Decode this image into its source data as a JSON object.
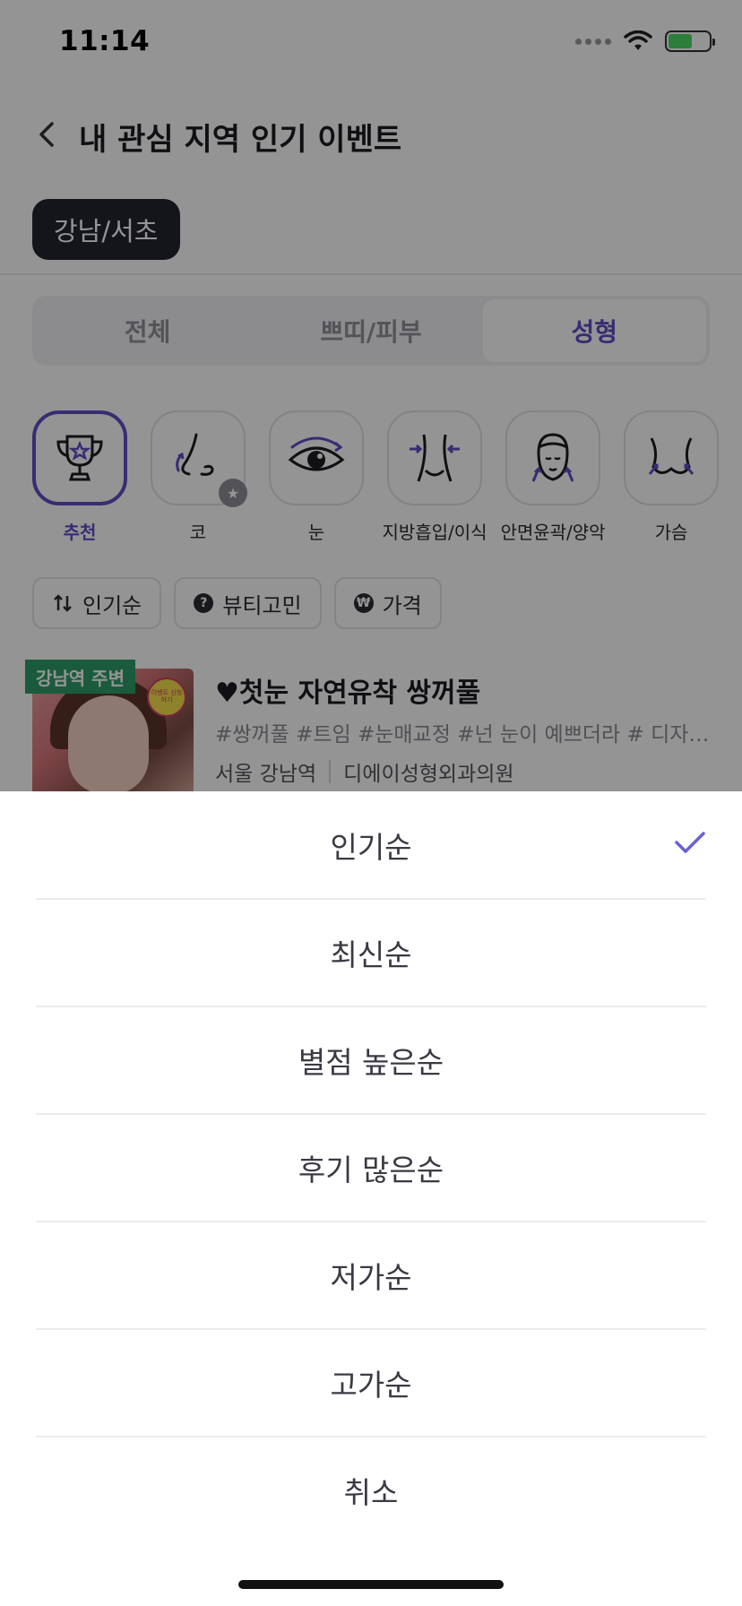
{
  "status_bar": {
    "time": "11:14",
    "battery_icon": "battery-charging-icon",
    "wifi_icon": "wifi-icon"
  },
  "header": {
    "title": "내 관심 지역 인기 이벤트",
    "back_icon": "chevron-left-icon"
  },
  "region_chip": "강남/서초",
  "segment": {
    "tabs": [
      "전체",
      "쁘띠/피부",
      "성형"
    ],
    "active_index": 2
  },
  "categories": [
    {
      "label": "추천",
      "icon": "trophy-icon",
      "active": true
    },
    {
      "label": "코",
      "icon": "nose-icon"
    },
    {
      "label": "눈",
      "icon": "eye-icon"
    },
    {
      "label": "지방흡입/이식",
      "icon": "waist-icon"
    },
    {
      "label": "안면윤곽/양악",
      "icon": "face-icon"
    },
    {
      "label": "가슴",
      "icon": "chest-icon"
    }
  ],
  "filters": [
    {
      "label": "인기순",
      "icon": "sort-icon"
    },
    {
      "label": "뷰티고민",
      "icon": "question-icon"
    },
    {
      "label": "가격",
      "icon": "won-icon"
    }
  ],
  "event": {
    "badge": "강남역 주변",
    "title": "♥첫눈 자연유착 쌍꺼풀",
    "tags": "#쌍꺼풀 #트임 #눈매교정 #넌 눈이 예쁘더라 # 디자인 쌍꺼풀",
    "location": "서울 강남역",
    "clinic": "디에이성형외과의원",
    "sticker": "이벤트 신청하기"
  },
  "sort_sheet": {
    "options": [
      "인기순",
      "최신순",
      "별점 높은순",
      "후기 많은순",
      "저가순",
      "고가순"
    ],
    "selected_index": 0,
    "cancel": "취소",
    "accent_color": "#6b5fd6"
  },
  "colors": {
    "accent": "#5f4ec7",
    "badge_green": "#2e9e6a"
  }
}
